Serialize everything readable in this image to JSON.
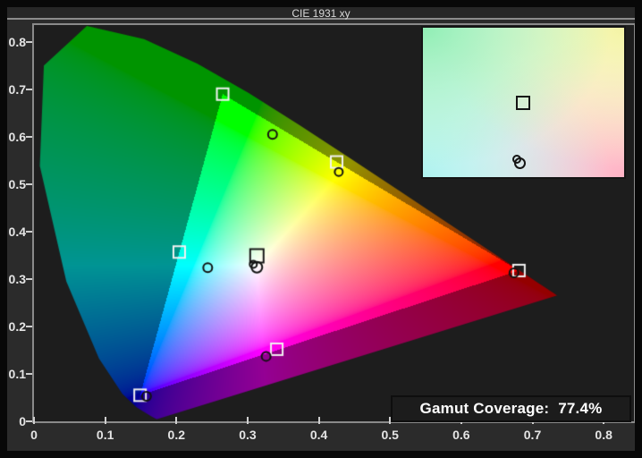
{
  "window": {
    "title": "CIE 1931 xy"
  },
  "status": {
    "label": "Gamut Coverage:",
    "value": "77.4%"
  },
  "colors": {
    "frame": "#080808",
    "window_bg": "#2b2b2b",
    "titlebar_border": "#8c8c8c",
    "plot_bg": "#1d1d1d",
    "plot_border": "#8a8a8a",
    "axis_text": "#e4e4e4",
    "tick": "#cfcfcf",
    "badge_bg": "#1c1c1c",
    "badge_text": "#ffffff",
    "target_marker_stroke": "#f2f2f2",
    "measured_marker_stroke": "#111111",
    "white_point_marker_stroke": "#181818"
  },
  "chart_data": {
    "type": "scatter",
    "title": "CIE 1931 xy",
    "xlabel": "",
    "ylabel": "",
    "xlim": [
      0,
      0.8425
    ],
    "ylim": [
      0,
      0.8357
    ],
    "grid": false,
    "legend": null,
    "tick_values": [
      0,
      0.1,
      0.2,
      0.3,
      0.4,
      0.5,
      0.6,
      0.7,
      0.8
    ],
    "x_tick_labels": [
      "0",
      "0.1",
      "0.2",
      "0.3",
      "0.4",
      "0.5",
      "0.6",
      "0.7",
      "0.8"
    ],
    "y_tick_labels": [
      "0",
      "0.1",
      "0.2",
      "0.3",
      "0.4",
      "0.5",
      "0.6",
      "0.7",
      "0.8"
    ],
    "spectral_locus_xy": [
      [
        0.1741,
        0.005
      ],
      [
        0.174,
        0.005
      ],
      [
        0.1733,
        0.0048
      ],
      [
        0.1726,
        0.0048
      ],
      [
        0.1714,
        0.0051
      ],
      [
        0.1689,
        0.0069
      ],
      [
        0.1644,
        0.0109
      ],
      [
        0.1566,
        0.0177
      ],
      [
        0.144,
        0.0297
      ],
      [
        0.1241,
        0.0578
      ],
      [
        0.0913,
        0.1327
      ],
      [
        0.0454,
        0.295
      ],
      [
        0.0082,
        0.5384
      ],
      [
        0.0139,
        0.7502
      ],
      [
        0.0743,
        0.8338
      ],
      [
        0.1547,
        0.8059
      ],
      [
        0.2296,
        0.7543
      ],
      [
        0.3016,
        0.6923
      ],
      [
        0.3731,
        0.6245
      ],
      [
        0.4441,
        0.5547
      ],
      [
        0.5125,
        0.4866
      ],
      [
        0.5752,
        0.4242
      ],
      [
        0.627,
        0.3725
      ],
      [
        0.6658,
        0.334
      ],
      [
        0.6915,
        0.3083
      ],
      [
        0.7079,
        0.292
      ],
      [
        0.719,
        0.2809
      ],
      [
        0.726,
        0.274
      ],
      [
        0.73,
        0.27
      ],
      [
        0.732,
        0.268
      ],
      [
        0.7334,
        0.2666
      ],
      [
        0.7344,
        0.2656
      ],
      [
        0.7347,
        0.2653
      ]
    ],
    "gamut_triangle": [
      [
        0.265,
        0.69
      ],
      [
        0.681,
        0.318
      ],
      [
        0.149,
        0.055
      ]
    ],
    "dim_factor_outside": 0.58,
    "target_points_squares": [
      {
        "name": "green-primary-target",
        "x": 0.265,
        "y": 0.69,
        "size": 13,
        "stroke": "#f2f2f2"
      },
      {
        "name": "red-primary-target",
        "x": 0.681,
        "y": 0.318,
        "size": 13,
        "stroke": "#f2f2f2"
      },
      {
        "name": "blue-primary-target",
        "x": 0.149,
        "y": 0.055,
        "size": 13,
        "stroke": "#f2f2f2"
      },
      {
        "name": "cyan-secondary-target",
        "x": 0.204,
        "y": 0.357,
        "size": 13,
        "stroke": "#f2f2f2"
      },
      {
        "name": "magenta-secondary-target",
        "x": 0.341,
        "y": 0.152,
        "size": 13,
        "stroke": "#f2f2f2"
      },
      {
        "name": "yellow-secondary-target",
        "x": 0.425,
        "y": 0.547,
        "size": 13,
        "stroke": "#f2f2f2"
      },
      {
        "name": "white-point-target",
        "x": 0.313,
        "y": 0.349,
        "size": 15,
        "stroke": "#181818"
      }
    ],
    "measured_points_circles": [
      {
        "name": "green-measured",
        "x": 0.335,
        "y": 0.605,
        "r": 5
      },
      {
        "name": "red-measured",
        "x": 0.674,
        "y": 0.313,
        "r": 5
      },
      {
        "name": "blue-measured",
        "x": 0.158,
        "y": 0.053,
        "r": 5
      },
      {
        "name": "cyan-measured",
        "x": 0.244,
        "y": 0.324,
        "r": 5
      },
      {
        "name": "magenta-measured",
        "x": 0.326,
        "y": 0.137,
        "r": 5
      },
      {
        "name": "yellow-measured",
        "x": 0.428,
        "y": 0.526,
        "r": 4.5
      },
      {
        "name": "white-measured-large",
        "x": 0.313,
        "y": 0.325,
        "r": 6
      },
      {
        "name": "white-measured-small",
        "x": 0.308,
        "y": 0.331,
        "r": 4
      }
    ],
    "gamut_coverage_percent": 77.4,
    "inset": {
      "corner_colors": [
        "#90eeb4",
        "#f4f4a4",
        "#aef2ee",
        "#ffb2c4"
      ],
      "corner_positions": [
        "0% 0%",
        "100% 0%",
        "0% 100%",
        "100% 100%"
      ],
      "square_marker_pct": {
        "x": 49.8,
        "y": 50.3
      },
      "circle_markers_pct": [
        {
          "x": 48.4,
          "y": 90.8,
          "d": 13
        },
        {
          "x": 46.5,
          "y": 88.2,
          "d": 10
        }
      ]
    }
  }
}
